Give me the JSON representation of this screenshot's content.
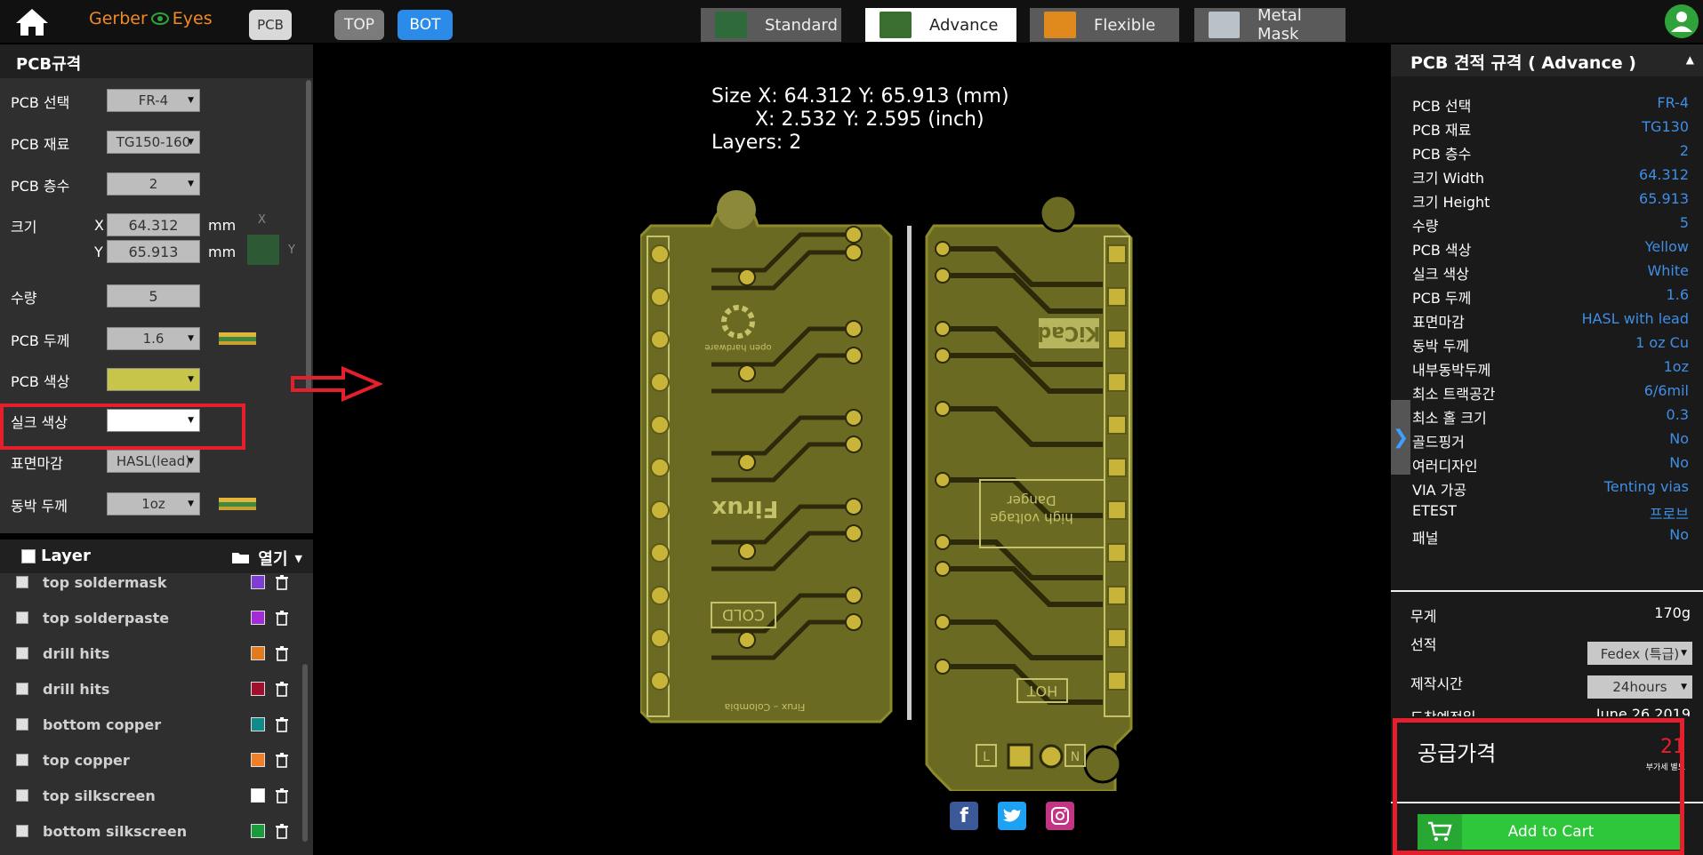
{
  "brand": {
    "name_part1": "Gerber",
    "name_part2": "Eyes"
  },
  "toolbar": {
    "pcb": "PCB",
    "top": "TOP",
    "bot": "BOT"
  },
  "tabs": [
    {
      "label": "Standard"
    },
    {
      "label": "Advance"
    },
    {
      "label": "Flexible"
    },
    {
      "label": "Metal Mask"
    }
  ],
  "left": {
    "title": "PCB규격",
    "pcb_select": {
      "label": "PCB 선택",
      "value": "FR-4"
    },
    "pcb_material": {
      "label": "PCB 재료",
      "value": "TG150-160"
    },
    "pcb_layers": {
      "label": "PCB 층수",
      "value": "2"
    },
    "size": {
      "label": "크기",
      "x_label": "X",
      "y_label": "Y",
      "x": "64.312",
      "y": "65.913",
      "unit": "mm",
      "x_hint": "X",
      "y_hint": "Y"
    },
    "quantity": {
      "label": "수량",
      "value": "5"
    },
    "thickness": {
      "label": "PCB 두께",
      "value": "1.6"
    },
    "color": {
      "label": "PCB 색상",
      "value": "",
      "swatch": "#c8c64a"
    },
    "silk": {
      "label": "실크 색상",
      "value": "",
      "swatch": "#ffffff"
    },
    "finish": {
      "label": "표면마감",
      "value": "HASL(lead)"
    },
    "copper": {
      "label": "동박 두께",
      "value": "1oz"
    }
  },
  "layer": {
    "title": "Layer",
    "open": "열기",
    "items": [
      {
        "name": "top soldermask",
        "color": "#7d3fd1"
      },
      {
        "name": "top solderpaste",
        "color": "#a32bd9"
      },
      {
        "name": "drill hits",
        "color": "#e07b1f"
      },
      {
        "name": "drill hits",
        "color": "#a0102c"
      },
      {
        "name": "bottom copper",
        "color": "#118a8a"
      },
      {
        "name": "top copper",
        "color": "#f07f2a"
      },
      {
        "name": "top silkscreen",
        "color": "#ffffff"
      },
      {
        "name": "bottom silkscreen",
        "color": "#1a9a3a"
      }
    ]
  },
  "info": {
    "size_line": "Size X: 64.312 Y: 65.913 (mm)",
    "inch_line": "       X: 2.532 Y: 2.595 (inch)",
    "layers_line": "Layers: 2"
  },
  "board": {
    "left_labels": [
      "open hardware",
      "Firux",
      "COLD",
      "Firux – Colombia"
    ],
    "right_labels": [
      "KiCad",
      "Danger",
      "high voltage",
      "HOT",
      "L",
      "N"
    ]
  },
  "right": {
    "title": "PCB 견적 규격 ( Advance )",
    "specs": [
      {
        "k": "PCB 선택",
        "v": "FR-4"
      },
      {
        "k": "PCB 재료",
        "v": "TG130"
      },
      {
        "k": "PCB 층수",
        "v": "2"
      },
      {
        "k": "크기 Width",
        "v": "64.312"
      },
      {
        "k": "크기 Height",
        "v": "65.913"
      },
      {
        "k": "수량",
        "v": "5"
      },
      {
        "k": "PCB 색상",
        "v": "Yellow"
      },
      {
        "k": "실크 색상",
        "v": "White"
      },
      {
        "k": "PCB 두께",
        "v": "1.6"
      },
      {
        "k": "표면마감",
        "v": "HASL with lead"
      },
      {
        "k": "동박 두께",
        "v": "1 oz Cu"
      },
      {
        "k": "내부동박두께",
        "v": "1oz"
      },
      {
        "k": "최소 트랙공간",
        "v": "6/6mil"
      },
      {
        "k": "최소 홀 크기",
        "v": "0.3"
      },
      {
        "k": "골드핑거",
        "v": "No"
      },
      {
        "k": "여러디자인",
        "v": "No"
      },
      {
        "k": "VIA 가공",
        "v": "Tenting vias"
      },
      {
        "k": "ETEST",
        "v": "프로브"
      },
      {
        "k": "패널",
        "v": "No"
      }
    ],
    "weight": {
      "label": "무게",
      "value": "170g"
    },
    "shipping": {
      "label": "선적",
      "value": "Fedex (특급)"
    },
    "production": {
      "label": "제작시간",
      "value": "24hours"
    },
    "arrival": {
      "label": "도착예정일",
      "value": "June 26 2019"
    },
    "price": {
      "label": "공급가격",
      "value": "21",
      "note": "부가세 별도"
    },
    "cart": "Add to Cart"
  },
  "colors": {
    "accent_red": "#e5202c",
    "link_blue": "#3f8ee6",
    "cart_green": "#2ec63b",
    "bot_blue": "#2b8be8"
  }
}
